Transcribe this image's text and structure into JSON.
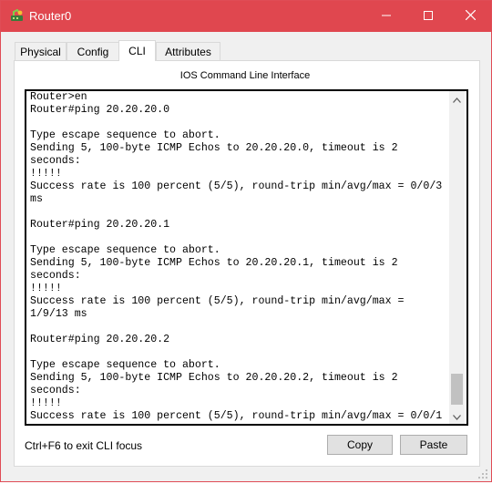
{
  "window": {
    "title": "Router0",
    "icons": {
      "app": "router-app-icon",
      "minimize": "minimize-icon",
      "maximize": "maximize-icon",
      "close": "close-icon"
    }
  },
  "colors": {
    "titlebar": "#e0474f",
    "panel_bg": "#ffffff",
    "window_bg": "#f0f0f0",
    "button_bg": "#e1e1e1",
    "scroll_thumb": "#c1c1c1"
  },
  "tabs": [
    {
      "label": "Physical",
      "active": false
    },
    {
      "label": "Config",
      "active": false
    },
    {
      "label": "CLI",
      "active": true
    },
    {
      "label": "Attributes",
      "active": false
    }
  ],
  "cli": {
    "heading": "IOS Command Line Interface",
    "lines": [
      "Router>en",
      "Router#ping 20.20.20.0",
      "",
      "Type escape sequence to abort.",
      "Sending 5, 100-byte ICMP Echos to 20.20.20.0, timeout is 2",
      "seconds:",
      "!!!!!",
      "Success rate is 100 percent (5/5), round-trip min/avg/max = 0/0/3",
      "ms",
      "",
      "Router#ping 20.20.20.1",
      "",
      "Type escape sequence to abort.",
      "Sending 5, 100-byte ICMP Echos to 20.20.20.1, timeout is 2",
      "seconds:",
      "!!!!!",
      "Success rate is 100 percent (5/5), round-trip min/avg/max =",
      "1/9/13 ms",
      "",
      "Router#ping 20.20.20.2",
      "",
      "Type escape sequence to abort.",
      "Sending 5, 100-byte ICMP Echos to 20.20.20.2, timeout is 2",
      "seconds:",
      "!!!!!",
      "Success rate is 100 percent (5/5), round-trip min/avg/max = 0/0/1"
    ],
    "scroll_position": 0.95
  },
  "footer": {
    "hint": "Ctrl+F6 to exit CLI focus",
    "copy_label": "Copy",
    "paste_label": "Paste"
  }
}
